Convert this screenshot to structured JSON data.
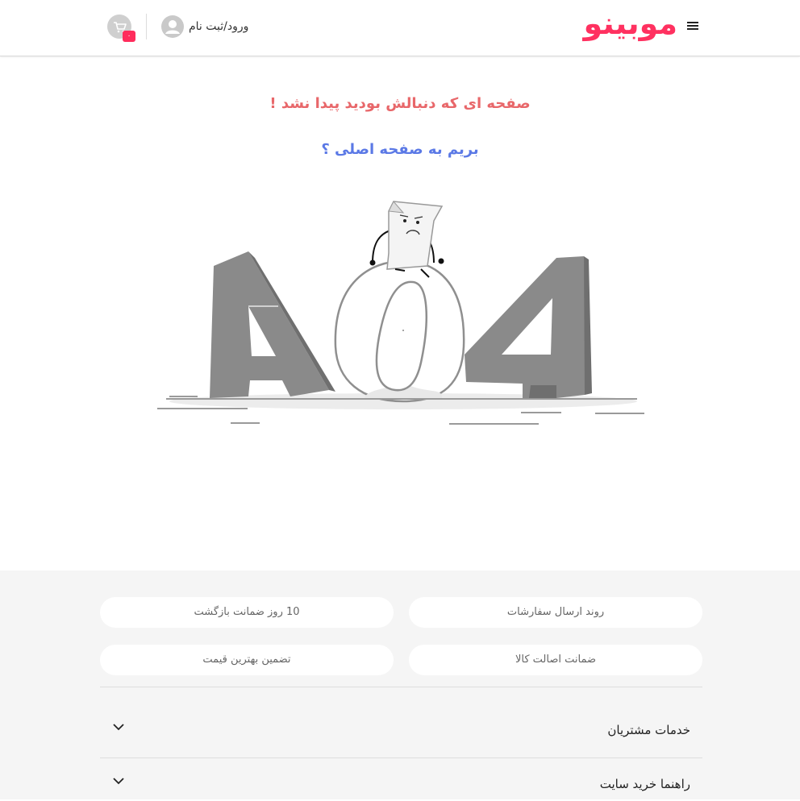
{
  "header": {
    "logo": "موبینو",
    "login_label": "ورود/ثبت نام",
    "cart_count": "۰"
  },
  "error": {
    "title": "صفحه ای که دنبالش بودید پیدا نشد !",
    "home_link": "بریم به صفحه اصلی ؟"
  },
  "colors": {
    "brand": "#ff3160",
    "error_title": "#e8676a",
    "link": "#5b79e6"
  },
  "footer": {
    "services": [
      "روند ارسال سفارشات",
      "10 روز ضمانت بازگشت",
      "ضمانت اصالت کالا",
      "تضمین بهترین قیمت"
    ],
    "accordions": [
      "خدمات مشتریان",
      "راهنما خرید سایت"
    ]
  }
}
